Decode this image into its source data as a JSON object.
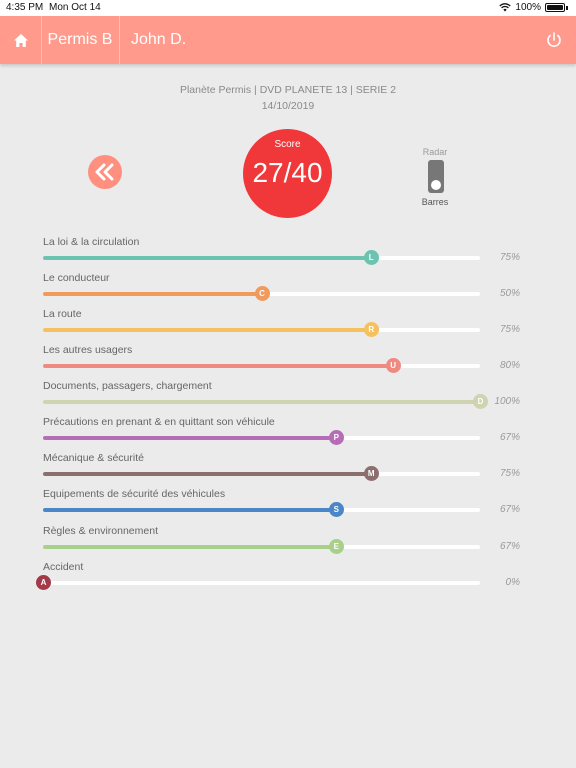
{
  "status": {
    "time": "4:35 PM",
    "date": "Mon Oct 14",
    "battery": "100%"
  },
  "nav": {
    "permis": "Permis B",
    "user": "John D.",
    "accent": "#ff9a8c"
  },
  "header": {
    "source": "Planète Permis | DVD PLANETE 13 | SERIE 2",
    "date": "14/10/2019"
  },
  "score": {
    "label": "Score",
    "value": "27/40",
    "color": "#f0373a"
  },
  "toggle": {
    "top_label": "Radar",
    "bottom_label": "Barres"
  },
  "categories": [
    {
      "name": "La loi & la circulation",
      "letter": "L",
      "percent": "75%",
      "value": 75,
      "color": "#6cc3b0"
    },
    {
      "name": "Le conducteur",
      "letter": "C",
      "percent": "50%",
      "value": 50,
      "color": "#f09a5c"
    },
    {
      "name": "La route",
      "letter": "R",
      "percent": "75%",
      "value": 75,
      "color": "#f5c05e"
    },
    {
      "name": "Les autres usagers",
      "letter": "U",
      "percent": "80%",
      "value": 80,
      "color": "#ee8a80"
    },
    {
      "name": "Documents, passagers, chargement",
      "letter": "D",
      "percent": "100%",
      "value": 100,
      "color": "#cfd3b0"
    },
    {
      "name": "Précautions en prenant & en quittant son véhicule",
      "letter": "P",
      "percent": "67%",
      "value": 67,
      "color": "#b56eb6"
    },
    {
      "name": "Mécanique & sécurité",
      "letter": "M",
      "percent": "75%",
      "value": 75,
      "color": "#8b6f6e"
    },
    {
      "name": "Equipements de sécurité des véhicules",
      "letter": "S",
      "percent": "67%",
      "value": 67,
      "color": "#4a86c8"
    },
    {
      "name": "Règles & environnement",
      "letter": "E",
      "percent": "67%",
      "value": 67,
      "color": "#a8d08a"
    },
    {
      "name": "Accident",
      "letter": "A",
      "percent": "0%",
      "value": 0,
      "color": "#a33a48"
    }
  ]
}
